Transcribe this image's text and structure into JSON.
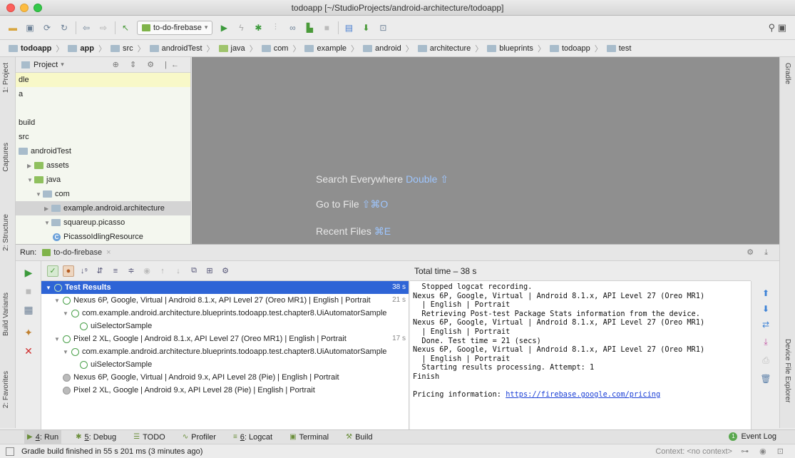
{
  "window": {
    "title": "todoapp [~/StudioProjects/android-architecture/todoapp]"
  },
  "toolbar": {
    "run_config": "to-do-firebase",
    "icons": [
      "open-icon",
      "save-icon",
      "sync-icon",
      "refresh-icon",
      "back-icon",
      "forward-icon",
      "make-icon",
      "run-icon",
      "debug-icon",
      "apply-changes-icon",
      "profile-icon",
      "attach-icon",
      "coverage-icon",
      "stop-icon",
      "sdk-manager-icon",
      "avd-manager-icon",
      "structure-icon",
      "search-icon"
    ]
  },
  "breadcrumb": [
    "todoapp",
    "app",
    "src",
    "androidTest",
    "java",
    "com",
    "example",
    "android",
    "architecture",
    "blueprints",
    "todoapp",
    "test"
  ],
  "left_stripe": {
    "project": "1: Project",
    "captures": "Captures",
    "structure": "2: Structure",
    "build_variants": "Build Variants",
    "favorites": "2: Favorites"
  },
  "right_stripe": {
    "gradle": "Gradle",
    "device_file_explorer": "Device File Explorer"
  },
  "project_panel": {
    "header": "Project",
    "rows": [
      {
        "label": "dle",
        "indent": 0,
        "highlight": true
      },
      {
        "label": "a",
        "indent": 0
      },
      {
        "label": "",
        "indent": 0
      },
      {
        "label": "build",
        "indent": 0
      },
      {
        "label": "src",
        "indent": 0
      },
      {
        "label": "androidTest",
        "indent": 0,
        "folder": true
      },
      {
        "label": "assets",
        "indent": 1,
        "folder": true,
        "green": true
      },
      {
        "label": "java",
        "indent": 1,
        "folder": true,
        "green": true,
        "open": true
      },
      {
        "label": "com",
        "indent": 2,
        "folder": true,
        "open": true
      },
      {
        "label": "example.android.architecture",
        "indent": 3,
        "folder": true,
        "selected": true
      },
      {
        "label": "squareup.picasso",
        "indent": 3,
        "folder": true,
        "open": true
      },
      {
        "label": "PicassoIdlingResource",
        "indent": 4,
        "class": true
      }
    ]
  },
  "editor_hints": [
    {
      "text": "Search Everywhere",
      "key": "Double ⇧"
    },
    {
      "text": "Go to File",
      "key": "⇧⌘O"
    },
    {
      "text": "Recent Files",
      "key": "⌘E"
    }
  ],
  "run_panel": {
    "label": "Run:",
    "tab": "to-do-firebase",
    "total_time": "Total time – 38 s",
    "tests": [
      {
        "label": "Test Results",
        "time": "38 s",
        "level": 0,
        "status": "pass",
        "selected": true
      },
      {
        "label": "Nexus 6P, Google, Virtual | Android 8.1.x, API Level 27 (Oreo MR1) | English | Portrait",
        "time": "21 s",
        "level": 1,
        "status": "pass"
      },
      {
        "label": "com.example.android.architecture.blueprints.todoapp.test.chapter8.UiAutomatorSample",
        "time": "",
        "level": 2,
        "status": "pass"
      },
      {
        "label": "uiSelectorSample",
        "time": "",
        "level": 3,
        "status": "pass"
      },
      {
        "label": "Pixel 2 XL, Google | Android 8.1.x, API Level 27 (Oreo MR1) | English | Portrait",
        "time": "17 s",
        "level": 1,
        "status": "pass"
      },
      {
        "label": "com.example.android.architecture.blueprints.todoapp.test.chapter8.UiAutomatorSample",
        "time": "",
        "level": 2,
        "status": "pass"
      },
      {
        "label": "uiSelectorSample",
        "time": "",
        "level": 3,
        "status": "pass"
      },
      {
        "label": "Nexus 6P, Google, Virtual | Android 9.x, API Level 28 (Pie) | English | Portrait",
        "time": "",
        "level": 1,
        "status": "skipped"
      },
      {
        "label": "Pixel 2 XL, Google | Android 9.x, API Level 28 (Pie) | English | Portrait",
        "time": "",
        "level": 1,
        "status": "skipped"
      }
    ],
    "console_lines": [
      "  Stopped logcat recording.",
      "Nexus 6P, Google, Virtual | Android 8.1.x, API Level 27 (Oreo MR1)",
      "  | English | Portrait",
      "  Retrieving Post-test Package Stats information from the device.",
      "Nexus 6P, Google, Virtual | Android 8.1.x, API Level 27 (Oreo MR1)",
      "  | English | Portrait",
      "  Done. Test time = 21 (secs)",
      "Nexus 6P, Google, Virtual | Android 8.1.x, API Level 27 (Oreo MR1)",
      "  | English | Portrait",
      "  Starting results processing. Attempt: 1",
      "Finish",
      ""
    ],
    "pricing_prefix": "Pricing information: ",
    "pricing_link": "https://firebase.google.com/pricing"
  },
  "tool_tabs": [
    {
      "num": "4",
      "label": ": Run",
      "icon": "run-icon",
      "active": true
    },
    {
      "num": "5",
      "label": ": Debug",
      "icon": "debug-icon"
    },
    {
      "num": "",
      "label": "TODO",
      "icon": "todo-icon"
    },
    {
      "num": "",
      "label": "Profiler",
      "icon": "profiler-icon"
    },
    {
      "num": "6",
      "label": ": Logcat",
      "icon": "logcat-icon"
    },
    {
      "num": "",
      "label": "Terminal",
      "icon": "terminal-icon"
    },
    {
      "num": "",
      "label": "Build",
      "icon": "build-icon"
    }
  ],
  "event_log": {
    "count": "1",
    "label": "Event Log"
  },
  "status": {
    "message": "Gradle build finished in 55 s 201 ms (3 minutes ago)",
    "context": "Context: <no context>"
  }
}
